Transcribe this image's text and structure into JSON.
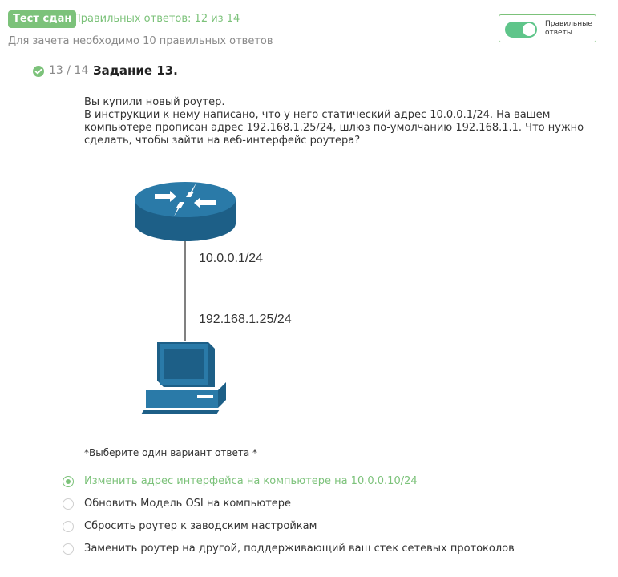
{
  "header": {
    "status_badge": "Тест сдан",
    "correct_answers": "Правильных ответов: 12 из 14",
    "requirement": "Для зачета необходимо 10 правильных ответов",
    "toggle_label": "Правильные ответы",
    "toggle_on": true
  },
  "question": {
    "progress": "13 / 14",
    "title": "Задание 13.",
    "text_lines": [
      "Вы купили новый роутер.",
      "В инструкции к нему написано, что у него статический адрес 10.0.0.1/24. На вашем компьютере прописан адрес 192.168.1.25/24, шлюз по-умолчанию 192.168.1.1. Что нужно сделать, чтобы зайти на веб-интерфейс роутера?"
    ],
    "diagram": {
      "router_label": "10.0.0.1/24",
      "pc_label": "192.168.1.25/24"
    },
    "hint": "*Выберите один вариант ответа *",
    "options": [
      {
        "label": "Изменить адрес интерфейса на компьютере на 10.0.0.10/24",
        "selected": true,
        "correct": true
      },
      {
        "label": "Обновить Модель OSI на компьютере",
        "selected": false,
        "correct": false
      },
      {
        "label": "Сбросить роутер к заводским настройкам",
        "selected": false,
        "correct": false
      },
      {
        "label": "Заменить роутер на другой, поддерживающий ваш стек сетевых протоколов",
        "selected": false,
        "correct": false
      }
    ]
  },
  "colors": {
    "accent_green": "#7cc27a",
    "toggle_green": "#5fc58a",
    "device_blue": "#1d5f87"
  },
  "icons": [
    "check-circle-icon",
    "router-icon",
    "computer-icon",
    "radio-icon"
  ]
}
